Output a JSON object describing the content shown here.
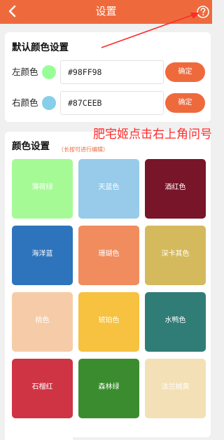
{
  "header": {
    "title": "设置",
    "back_icon": "chevron-left-icon",
    "help_icon": "question-circle-icon",
    "background": "#ee6a3d"
  },
  "default_colors": {
    "title": "默认颜色设置",
    "left": {
      "label": "左颜色",
      "value": "#98FF98",
      "color": "#98ff98",
      "button": "确定"
    },
    "right": {
      "label": "右颜色",
      "value": "#87CEEB",
      "color": "#87ceeb",
      "button": "确定"
    }
  },
  "annotation": {
    "text": "肥宅姬点击右上角问号",
    "color": "#ff2a2a"
  },
  "color_settings": {
    "title": "颜色设置",
    "hint": "（长按可进行编辑）",
    "swatches": [
      {
        "label": "薄荷绿",
        "color": "#a6fa96"
      },
      {
        "label": "天蓝色",
        "color": "#97cbe9"
      },
      {
        "label": "酒红色",
        "color": "#781528"
      },
      {
        "label": "海洋蓝",
        "color": "#2e74bd"
      },
      {
        "label": "珊瑚色",
        "color": "#f08c5e"
      },
      {
        "label": "深卡其色",
        "color": "#d4ba5c"
      },
      {
        "label": "桃色",
        "color": "#f6cca8"
      },
      {
        "label": "琥珀色",
        "color": "#f6c23f"
      },
      {
        "label": "水鸭色",
        "color": "#307d78"
      },
      {
        "label": "石榴红",
        "color": "#cf3444"
      },
      {
        "label": "森林绿",
        "color": "#3b8c2f"
      },
      {
        "label": "法兰绒黄",
        "color": "#f3e0b6"
      }
    ]
  }
}
